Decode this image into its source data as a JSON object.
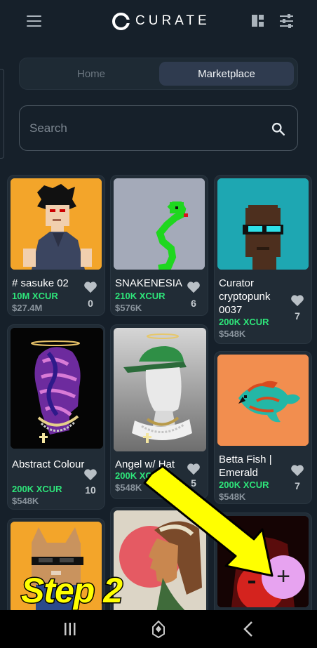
{
  "header": {
    "brand": "CURATE",
    "menu_icon": "hamburger-menu-icon",
    "view_icon": "grid-layout-icon",
    "filter_icon": "sliders-filter-icon"
  },
  "tabs": [
    {
      "label": "Home",
      "active": false
    },
    {
      "label": "Marketplace",
      "active": true
    }
  ],
  "search": {
    "placeholder": "Search",
    "icon": "search-icon"
  },
  "cards": [
    {
      "name": "# sasuke 02",
      "price": "10M XCUR",
      "usd": "$27.4M",
      "likes": "0"
    },
    {
      "name": "SNAKENESIA",
      "price": "210K XCUR",
      "usd": "$576K",
      "likes": "6"
    },
    {
      "name": "Curator cryptopunk 0037",
      "price": "200K XCUR",
      "usd": "$548K",
      "likes": "7"
    },
    {
      "name": "Abstract Colour",
      "price": "200K XCUR",
      "usd": "$548K",
      "likes": "10"
    },
    {
      "name": "Angel w/ Hat",
      "price": "200K XCUR",
      "usd": "$548K",
      "likes": "5"
    },
    {
      "name": "Betta Fish | Emerald",
      "price": "200K XCUR",
      "usd": "$548K",
      "likes": "7"
    }
  ],
  "fab": {
    "label": "+",
    "icon": "plus-icon"
  },
  "annotation": {
    "step_text": "Step 2",
    "arrow_color": "#ffff00"
  },
  "colors": {
    "background": "#16202a",
    "price_green": "#2ee57a",
    "fab": "#e7a3f0",
    "active_tab": "#2f3b4f"
  },
  "system_nav": [
    "recent-apps-icon",
    "home-icon",
    "back-icon"
  ]
}
